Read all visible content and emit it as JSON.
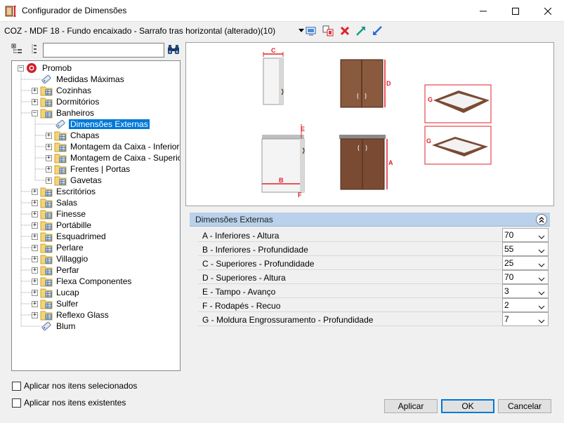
{
  "window": {
    "title": "Configurador de Dimensões",
    "icon": "ruler-cabinet-icon"
  },
  "toolbar": {
    "item_path": "COZ - MDF 18 - Fundo encaixado - Sarrafo tras horizontal (alterado)(10)",
    "icons": [
      "dropdown-arrow-icon",
      "screen-icon",
      "copy-item-icon",
      "delete-x-icon",
      "expand-arrow-icon",
      "collapse-arrow-icon"
    ]
  },
  "search": {
    "value": "",
    "placeholder": ""
  },
  "tree": {
    "root": "Promob",
    "nodes": [
      {
        "label": "Medidas Máximas",
        "level": 1,
        "type": "tag",
        "expander": "none"
      },
      {
        "label": "Cozinhas",
        "level": 1,
        "type": "folder",
        "expander": "+"
      },
      {
        "label": "Dormitórios",
        "level": 1,
        "type": "folder",
        "expander": "+"
      },
      {
        "label": "Banheiros",
        "level": 1,
        "type": "folder",
        "expander": "-"
      },
      {
        "label": "Dimensões Externas",
        "level": 2,
        "type": "tag",
        "expander": "none",
        "selected": true
      },
      {
        "label": "Chapas",
        "level": 2,
        "type": "folder",
        "expander": "+"
      },
      {
        "label": "Montagem da Caixa - Inferior",
        "level": 2,
        "type": "folder",
        "expander": "+"
      },
      {
        "label": "Montagem de Caixa - Superior",
        "level": 2,
        "type": "folder",
        "expander": "+"
      },
      {
        "label": "Frentes | Portas",
        "level": 2,
        "type": "folder",
        "expander": "+"
      },
      {
        "label": "Gavetas",
        "level": 2,
        "type": "folder",
        "expander": "+"
      },
      {
        "label": "Escritórios",
        "level": 1,
        "type": "folder",
        "expander": "+"
      },
      {
        "label": "Salas",
        "level": 1,
        "type": "folder",
        "expander": "+"
      },
      {
        "label": "Finesse",
        "level": 1,
        "type": "folder",
        "expander": "+"
      },
      {
        "label": "Portábille",
        "level": 1,
        "type": "folder",
        "expander": "+"
      },
      {
        "label": "Esquadrimed",
        "level": 1,
        "type": "folder",
        "expander": "+"
      },
      {
        "label": "Perlare",
        "level": 1,
        "type": "folder",
        "expander": "+"
      },
      {
        "label": "Villaggio",
        "level": 1,
        "type": "folder",
        "expander": "+"
      },
      {
        "label": "Perfar",
        "level": 1,
        "type": "folder",
        "expander": "+"
      },
      {
        "label": "Flexa Componentes",
        "level": 1,
        "type": "folder",
        "expander": "+"
      },
      {
        "label": "Lucap",
        "level": 1,
        "type": "folder",
        "expander": "+"
      },
      {
        "label": "Sulfer",
        "level": 1,
        "type": "folder",
        "expander": "+"
      },
      {
        "label": "Reflexo Glass",
        "level": 1,
        "type": "folder",
        "expander": "+"
      },
      {
        "label": "Blum",
        "level": 1,
        "type": "tag",
        "expander": "none"
      }
    ]
  },
  "preview": {
    "labels": {
      "a": "A",
      "b": "B",
      "c": "C",
      "d": "D",
      "e": "E",
      "f": "F",
      "g": "G"
    }
  },
  "properties": {
    "header": "Dimensões Externas",
    "rows": [
      {
        "label": "A - Inferiores - Altura",
        "value": "70"
      },
      {
        "label": "B - Inferiores - Profundidade",
        "value": "55"
      },
      {
        "label": "C - Superiores - Profundidade",
        "value": "25"
      },
      {
        "label": "D - Superiores - Altura",
        "value": "70"
      },
      {
        "label": "E - Tampo - Avanço",
        "value": "3"
      },
      {
        "label": "F - Rodapés - Recuo",
        "value": "2"
      },
      {
        "label": "G - Moldura Engrossuramento - Profundidade",
        "value": "7"
      }
    ]
  },
  "options": {
    "apply_selected": "Aplicar nos itens selecionados",
    "apply_existing": "Aplicar nos itens existentes"
  },
  "buttons": {
    "apply": "Aplicar",
    "ok": "OK",
    "cancel": "Cancelar"
  },
  "colors": {
    "selection": "#0078d7",
    "panel_header": "#b9d1ea",
    "dimension": "#e0202a",
    "wood": "#7a4a32"
  }
}
